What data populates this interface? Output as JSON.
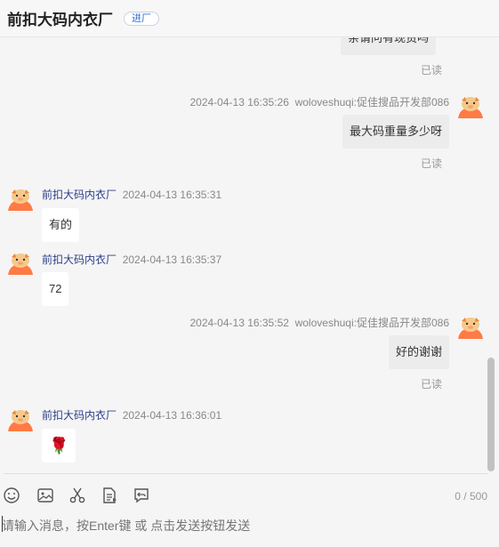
{
  "header": {
    "title": "前扣大码内衣厂",
    "tag": "进厂"
  },
  "messages": [
    {
      "side": "me",
      "text": "亲请问有现货吗",
      "status": "已读"
    },
    {
      "side": "me",
      "timestamp": "2024-04-13 16:35:26",
      "sender": "woloveshuqi:促佳搜品开发部086",
      "text": "最大码重量多少呀",
      "status": "已读"
    },
    {
      "side": "other",
      "sender": "前扣大码内衣厂",
      "timestamp": "2024-04-13 16:35:31",
      "text": "有的"
    },
    {
      "side": "other",
      "sender": "前扣大码内衣厂",
      "timestamp": "2024-04-13 16:35:37",
      "text": "72"
    },
    {
      "side": "me",
      "timestamp": "2024-04-13 16:35:52",
      "sender": "woloveshuqi:促佳搜品开发部086",
      "text": "好的谢谢",
      "status": "已读"
    },
    {
      "side": "other",
      "sender": "前扣大码内衣厂",
      "timestamp": "2024-04-13 16:36:01",
      "text": "🌹"
    }
  ],
  "toolbar": {
    "icons": [
      "emoji-icon",
      "image-icon",
      "scissors-icon",
      "document-icon",
      "history-icon"
    ],
    "counter": "0 / 500"
  },
  "input": {
    "placeholder": "请输入消息，按Enter键 或 点击发送按钮发送",
    "value": ""
  }
}
